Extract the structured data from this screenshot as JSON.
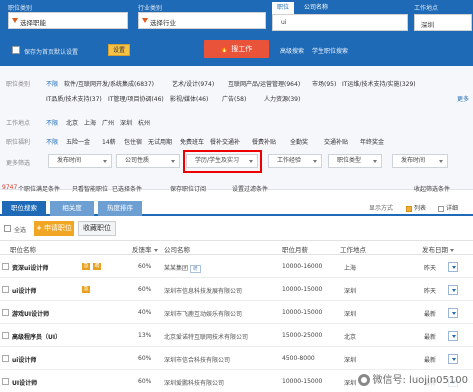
{
  "search": {
    "job_label": "职位类别",
    "job_value": "选择职能",
    "industry_label": "行业类别",
    "industry_value": "选择行业",
    "seg_job": "职位",
    "seg_company": "公司名称",
    "keyword": "ui",
    "city_label": "工作地点",
    "city_value": "深圳",
    "home_checkbox_label": "保存为首页默认设置",
    "set_button": "设置",
    "find_button": "搜工作",
    "advanced": "高级搜索",
    "history": "学生职位搜索"
  },
  "filters": {
    "job_class": {
      "label": "职位类别",
      "items": [
        "不限",
        "软件/互联网开发/系统集成(6837)",
        "艺术/设计(974)",
        "互联网产品/运营管理(964)",
        "市场(95)",
        "IT运维/技术支持/实施(329)"
      ],
      "items2": [
        "IT品质/技术支持(37)",
        "IT管理/项目协调(46)",
        "影视/媒体(46)",
        "广告(58)",
        "人力资源(39)"
      ],
      "more": "更多"
    },
    "work_place": {
      "label": "工作地点",
      "items": [
        "不限",
        "北京",
        "上海",
        "广州",
        "深圳",
        "杭州"
      ]
    },
    "welfare": {
      "label": "职位福利",
      "items": [
        "不限",
        "五险一金",
        "14薪",
        "包住宿",
        "无试用期",
        "免费班车",
        "餐补交通补",
        "餐费补贴",
        "全勤奖",
        "交通补贴",
        "年终奖金"
      ]
    },
    "more_label": "更多筛选",
    "dropdowns": [
      "发布时间",
      "公司性质",
      "学历/学生及实习",
      "工作经验",
      "职位类型",
      "发布时间"
    ],
    "results": {
      "count": "9747",
      "count_text": "个职位满足条件",
      "smart": "只看智能职位",
      "already": "已选择条件",
      "subscribe": "保存职位订阅",
      "filter_text": "设置过滤条件",
      "collapse": "收起筛选条件"
    }
  },
  "tabs": {
    "items": [
      "职位搜索",
      "相关度",
      "热度排序"
    ],
    "view_label": "显示方式",
    "view_list": "列表",
    "view_detail": "详细"
  },
  "actions": {
    "select_all": "全选",
    "apply": "申请职位",
    "save": "收藏职位"
  },
  "table": {
    "headers": [
      "职位名称",
      "反馈率",
      "公司名称",
      "职位月薪",
      "工作地点",
      "发布日期"
    ],
    "rows": [
      {
        "title": "资深ui设计师",
        "tags": [
          "急",
          "聘"
        ],
        "rate": "60%",
        "company": "某某集团",
        "badge": "聘",
        "salary": "10000-16000",
        "place": "上海",
        "date": "昨天"
      },
      {
        "title": "ui设计师",
        "tags": [
          "急"
        ],
        "rate": "60%",
        "company": "深圳市信息科技发展有限公司",
        "badge": "",
        "salary": "10000-15000",
        "place": "深圳",
        "date": "昨天"
      },
      {
        "title": "游戏UI设计师",
        "tags": [],
        "rate": "40%",
        "company": "深圳市飞鹿互动娱乐有限公司",
        "badge": "",
        "salary": "10000-15000",
        "place": "深圳",
        "date": "最新"
      },
      {
        "title": "高级程序员（UI）",
        "tags": [],
        "rate": "13%",
        "company": "北京爱诺特互联网技术有限公司",
        "badge": "",
        "salary": "15000-25000",
        "place": "北京",
        "date": "最新"
      },
      {
        "title": "ui设计师",
        "tags": [],
        "rate": "60%",
        "company": "深圳市信合科技有限公司",
        "badge": "",
        "salary": "4500-8000",
        "place": "深圳",
        "date": "最新"
      },
      {
        "title": "UI设计师",
        "tags": [],
        "rate": "60%",
        "company": "深圳爱鹏科技有限公司",
        "badge": "",
        "salary": "10000-15000",
        "place": "深圳",
        "date": "最新"
      }
    ]
  },
  "watermark": {
    "text": "微信号: luojin05100"
  },
  "colors": {
    "brand_blue": "#1e6ab6",
    "find_red": "#e9533a",
    "apply_orange": "#f1a623",
    "highlight_red": "#e00000"
  }
}
